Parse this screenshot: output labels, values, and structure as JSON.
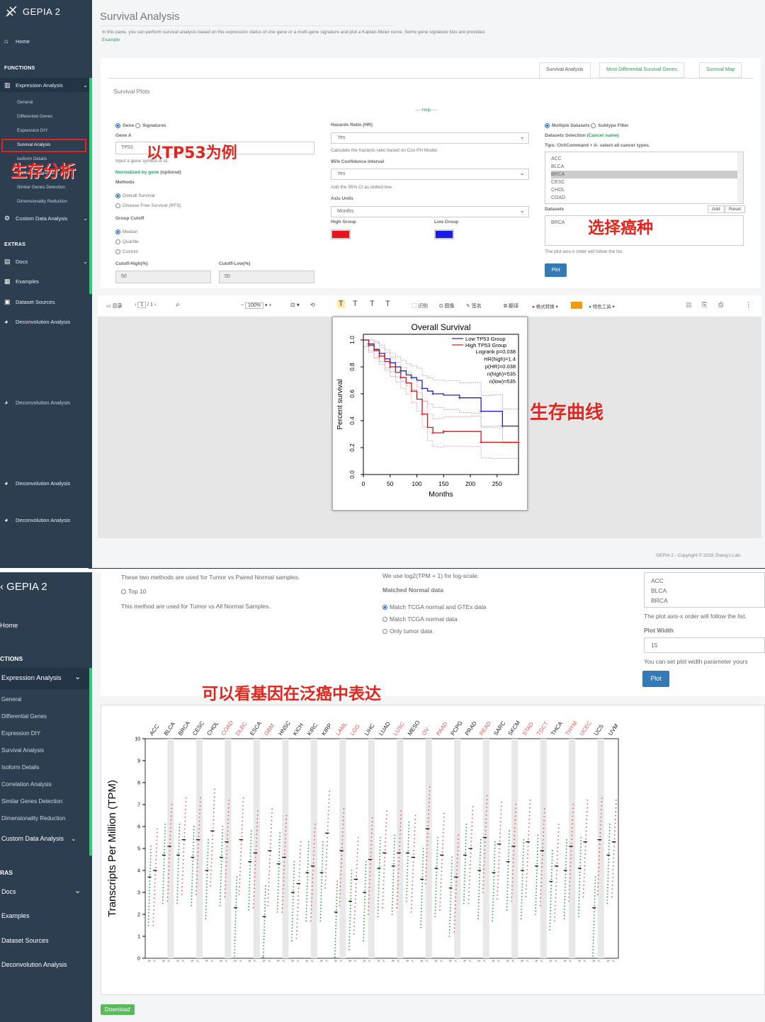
{
  "app": {
    "logo": "GEPIA 2"
  },
  "sidebar1": {
    "home": "Home",
    "functions_header": "FUNCTIONS",
    "expression_analysis": "Expression Analysis",
    "subs": [
      "General",
      "Differential Genes",
      "Expression DIY",
      "Survival Analysis",
      "Isoform Details",
      "Correlation Analysis",
      "Similar Genes Detection",
      "Dimensionality Reduction"
    ],
    "custom_data": "Custom Data Analysis",
    "extras_header": "EXTRAS",
    "docs": "Docs",
    "examples": "Examples",
    "dataset_sources": "Dataset Sources",
    "deconv": "Deconvolution Analysis"
  },
  "sidebar2": {
    "logo": "GEPIA 2",
    "home": "Home",
    "functions_header": "CTIONS",
    "expression_analysis": "Expression Analysis",
    "subs": [
      "General",
      "Differential Genes",
      "Expression DIY",
      "Survival Analysis",
      "Isoform Details",
      "Correlation Analysis",
      "Similar Genes Detection",
      "Dimensionality Reduction"
    ],
    "custom_data": "Custom Data Analysis",
    "extras_header": "RAS",
    "docs": "Docs",
    "examples": "Examples",
    "dataset_sources": "Dataset Sources",
    "deconv": "Deconvolution Analysis"
  },
  "page": {
    "title": "Survival Analysis",
    "description": "In this pane, you can perform survival analysis based on the expression status of one gene or a multi-gene signature and plot a Kaplan-Meier curve. Some gene signature lists are provided.",
    "example_link": "Example",
    "tabs": [
      "Survival Analysis",
      "Most Differential Survival Genes",
      "Survival Map"
    ],
    "panel_title": "Survival Plots",
    "help": "--- Help ---"
  },
  "form": {
    "gene_label": "Gene",
    "signatures_label": "Signatures",
    "gene_a_label": "Gene A",
    "gene_a_value": "TP53",
    "gene_hint": "Input a gene symbol or id.",
    "normalized_label": "Normalized by gene",
    "optional": "(optional)",
    "methods_label": "Methods",
    "overall_survival": "Overall Survival",
    "dfs": "Disease Free Survival (RFS)",
    "group_cutoff": "Group Cutoff",
    "median": "Median",
    "quartile": "Quartile",
    "custom": "Custom",
    "cutoff_high_label": "Cutoff-High(%)",
    "cutoff_high": "50",
    "cutoff_low_label": "Cutoff-Low(%)",
    "cutoff_low": "50",
    "hr_label": "Hazards Ratio (HR)",
    "hr_value": "Yes",
    "hr_hint": "Calculate the hazards ratio based on Cox PH Model.",
    "ci_label": "95% Confidence Interval",
    "ci_value": "Yes",
    "ci_hint": "Add the 95% CI as dotted line.",
    "axis_units_label": "Axis Units",
    "axis_units_value": "Months",
    "high_group": "High Group",
    "low_group": "Low Group",
    "high_color": "#e8141b",
    "low_color": "#1a1ae6",
    "multiple_datasets": "Multiple Datasets",
    "subtype_filter": "Subtype Filter",
    "datasets_selection": "Datasets Selection",
    "cancer_name": "(Cancer name)",
    "tips": "Tips: Ctrl/Command + A: select all cancer types.",
    "dataset_list": [
      "ACC",
      "BLCA",
      "BRCA",
      "CESC",
      "CHOL",
      "COAD"
    ],
    "datasets_label": "Datasets",
    "add": "Add",
    "reset": "Reset",
    "datasets_value": "BRCA",
    "order_hint": "The plot axis-x order will follow the list.",
    "plot": "Plot"
  },
  "toolbar": {
    "toc": "目录",
    "page": "1",
    "pages": "/ 1",
    "zoom": "100%",
    "ocr": "识别",
    "img": "图像",
    "sign": "签名",
    "translate": "翻译",
    "convert": "格式转换",
    "special": "特色工具"
  },
  "chart_data": [
    {
      "type": "line",
      "title": "Overall Survival",
      "xlabel": "Months",
      "ylabel": "Percent survival",
      "xlim": [
        0,
        290
      ],
      "ylim": [
        0,
        1.0
      ],
      "xticks": [
        "0",
        "50",
        "100",
        "150",
        "200",
        "250"
      ],
      "yticks": [
        "0.0",
        "0.2",
        "0.4",
        "0.6",
        "0.8",
        "1.0"
      ],
      "legend_placement": "top-right",
      "legend": [
        "Low TP53 Group",
        "High TP53 Group"
      ],
      "stats": [
        "Logrank p=0.038",
        "HR(high)=1.4",
        "p(HR)=0.038",
        "n(high)=535",
        "n(low)=535"
      ],
      "series": [
        {
          "name": "Low TP53 Group",
          "color": "#2222bb",
          "x": [
            0,
            10,
            20,
            30,
            40,
            50,
            60,
            70,
            80,
            90,
            100,
            110,
            120,
            130,
            150,
            180,
            200,
            220,
            240,
            260,
            290
          ],
          "y": [
            1.0,
            0.97,
            0.93,
            0.9,
            0.86,
            0.83,
            0.8,
            0.77,
            0.74,
            0.72,
            0.7,
            0.64,
            0.62,
            0.6,
            0.59,
            0.57,
            0.57,
            0.47,
            0.47,
            0.36,
            0.36
          ]
        },
        {
          "name": "High TP53 Group",
          "color": "#dd1111",
          "x": [
            0,
            10,
            20,
            30,
            40,
            50,
            60,
            70,
            80,
            90,
            100,
            110,
            120,
            130,
            140,
            150,
            200,
            220,
            240,
            290
          ],
          "y": [
            1.0,
            0.96,
            0.92,
            0.88,
            0.84,
            0.8,
            0.76,
            0.72,
            0.68,
            0.62,
            0.56,
            0.45,
            0.35,
            0.31,
            0.31,
            0.32,
            0.32,
            0.24,
            0.24,
            0.24
          ]
        }
      ]
    },
    {
      "type": "scatter",
      "ylabel": "Transcripts Per Million (TPM)",
      "ylim": [
        0,
        10
      ],
      "yticks": [
        "0",
        "1",
        "2",
        "3",
        "4",
        "5",
        "6",
        "7",
        "8",
        "9",
        "10"
      ],
      "categories": [
        "ACC",
        "BLCA",
        "BRCA",
        "CESC",
        "CHOL",
        "COAD",
        "DLBC",
        "ESCA",
        "GBM",
        "HNSC",
        "KICH",
        "KIRC",
        "KIRP",
        "LAML",
        "LGG",
        "LIHC",
        "LUAD",
        "LUSC",
        "MESO",
        "OV",
        "PAAD",
        "PCPG",
        "PRAD",
        "READ",
        "SARC",
        "SKCM",
        "STAD",
        "TGCT",
        "THCA",
        "THYM",
        "UCEC",
        "UCS",
        "UVM"
      ],
      "highlighted": [
        "COAD",
        "DLBC",
        "GBM",
        "LAML",
        "LGG",
        "LUSC",
        "OV",
        "PAAD",
        "READ",
        "STAD",
        "TGCT",
        "THYM",
        "UCEC"
      ],
      "tumor_median": [
        4.0,
        5.1,
        5.4,
        5.4,
        5.8,
        5.3,
        5.4,
        4.8,
        4.9,
        4.6,
        3.4,
        4.2,
        5.7,
        4.9,
        3.6,
        4.5,
        4.8,
        4.8,
        4.6,
        5.9,
        4.7,
        3.7,
        5.0,
        5.5,
        5.2,
        5.1,
        5.3,
        4.9,
        4.2,
        5.1,
        5.3,
        5.4,
        5.3
      ],
      "normal_median": [
        3.7,
        4.7,
        4.7,
        4.6,
        4.0,
        4.6,
        2.3,
        4.4,
        1.9,
        4.3,
        3.0,
        3.9,
        3.9,
        2.1,
        2.6,
        3.0,
        4.1,
        4.2,
        4.8,
        3.6,
        4.1,
        3.2,
        4.7,
        4.0,
        3.9,
        4.4,
        4.0,
        4.2,
        3.5,
        4.0,
        4.1,
        2.3,
        4.7
      ],
      "tumor_color": "#e05a5a",
      "normal_color": "#2e9e48"
    }
  ],
  "footer": {
    "copyright": "GEPIA 2 - Copyright © 2018 Zhang's Lab."
  },
  "lower": {
    "methods_note": "These two methods are used for Tumor vs Paired Normal samples.",
    "top10": "Top 10",
    "method_note2": "This method are used for Tumor vs All Normal Samples.",
    "log_note": "We use log2(TPM + 1) for log-scale.",
    "matched_label": "Matched Normal data",
    "match_gtex": "Match TCGA normal and GTEx data",
    "match_tcga": "Match TCGA normal data",
    "only_tumor": "Only tumor data",
    "list": [
      "ACC",
      "BLCA",
      "BRCA"
    ],
    "order_hint": "The plot axis-x order will follow the list.",
    "plot_width_label": "Plot Width",
    "plot_width": "15",
    "plot_width_hint": "You can set plot width parameter yours",
    "plot": "Plot",
    "download": "Download"
  },
  "annotations": {
    "tp53": "以TP53为例",
    "survival": "生存分析",
    "cancer": "选择癌种",
    "curve": "生存曲线",
    "pancancer": "可以看基因在泛癌中表达"
  }
}
